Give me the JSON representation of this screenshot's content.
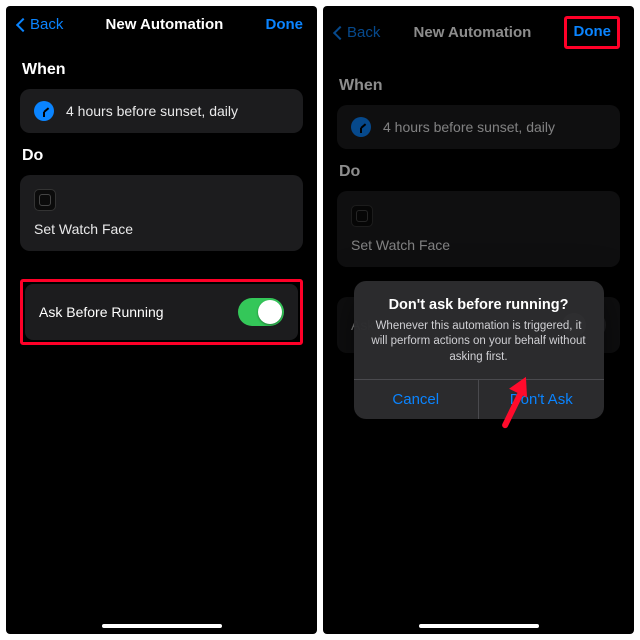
{
  "nav": {
    "back": "Back",
    "title": "New Automation",
    "done": "Done"
  },
  "sections": {
    "when": "When",
    "do": "Do"
  },
  "when_card": {
    "text": "4 hours before sunset, daily"
  },
  "do_card": {
    "text": "Set Watch Face"
  },
  "ask_row": {
    "label": "Ask Before Running"
  },
  "ask_row_short": {
    "label": "Ask"
  },
  "dialog": {
    "title": "Don't ask before running?",
    "message": "Whenever this automation is triggered, it will perform actions on your behalf without asking first.",
    "cancel": "Cancel",
    "confirm": "Don't Ask"
  }
}
